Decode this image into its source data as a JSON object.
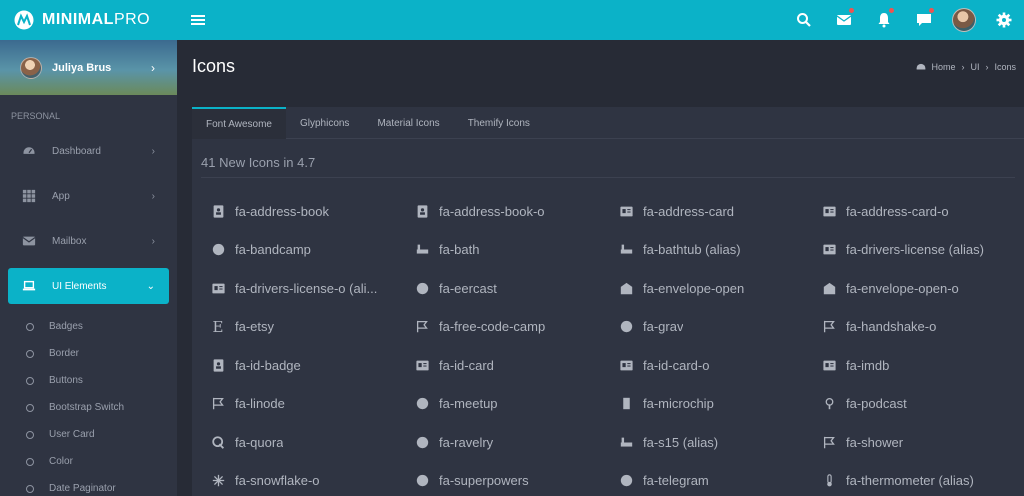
{
  "brand": {
    "bold": "MINIMAL",
    "light": "PRO"
  },
  "sidebar": {
    "user_name": "Juliya Brus",
    "section_label": "PERSONAL",
    "nav": [
      {
        "label": "Dashboard",
        "icon": "dashboard-icon"
      },
      {
        "label": "App",
        "icon": "apps-grid-icon"
      },
      {
        "label": "Mailbox",
        "icon": "mailbox-icon"
      },
      {
        "label": "UI Elements",
        "icon": "laptop-icon",
        "active": true
      }
    ],
    "sub_items": [
      "Badges",
      "Border",
      "Buttons",
      "Bootstrap Switch",
      "User Card",
      "Color",
      "Date Paginator"
    ]
  },
  "page": {
    "title": "Icons",
    "breadcrumb": [
      "Home",
      "UI",
      "Icons"
    ]
  },
  "tabs": [
    "Font Awesome",
    "Glyphicons",
    "Material Icons",
    "Themify Icons"
  ],
  "section_title": "41 New Icons in 4.7",
  "icons": [
    "fa-address-book",
    "fa-address-book-o",
    "fa-address-card",
    "fa-address-card-o",
    "fa-bandcamp",
    "fa-bath",
    "fa-bathtub (alias)",
    "fa-drivers-license (alias)",
    "fa-drivers-license-o (ali...",
    "fa-eercast",
    "fa-envelope-open",
    "fa-envelope-open-o",
    "fa-etsy",
    "fa-free-code-camp",
    "fa-grav",
    "fa-handshake-o",
    "fa-id-badge",
    "fa-id-card",
    "fa-id-card-o",
    "fa-imdb",
    "fa-linode",
    "fa-meetup",
    "fa-microchip",
    "fa-podcast",
    "fa-quora",
    "fa-ravelry",
    "fa-s15 (alias)",
    "fa-shower",
    "fa-snowflake-o",
    "fa-superpowers",
    "fa-telegram",
    "fa-thermometer (alias)"
  ],
  "colors": {
    "accent": "#0bb2c8",
    "notification": "#ef5350"
  }
}
